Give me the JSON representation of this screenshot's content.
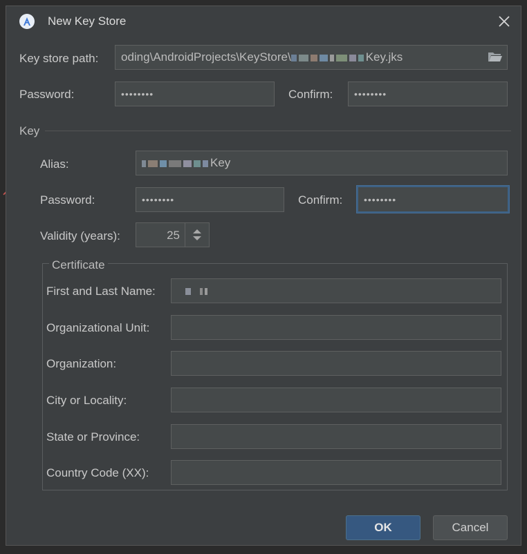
{
  "window": {
    "title": "New Key Store",
    "close_label": "×"
  },
  "keystore": {
    "path_label": "Key store path:",
    "path_value": "oding\\AndroidProjects\\KeyStore\\",
    "path_suffix": "Key.jks",
    "password_label": "Password:",
    "password_value": "••••••••",
    "confirm_label": "Confirm:",
    "confirm_value": "••••••••"
  },
  "key": {
    "section_label": "Key",
    "alias_label": "Alias:",
    "alias_suffix": "Key",
    "password_label": "Password:",
    "password_value": "••••••••",
    "confirm_label": "Confirm:",
    "confirm_value": "••••••••",
    "validity_label": "Validity (years):",
    "validity_value": "25"
  },
  "certificate": {
    "title": "Certificate",
    "fields": [
      {
        "label": "First and Last Name:",
        "value": ""
      },
      {
        "label": "Organizational Unit:",
        "value": ""
      },
      {
        "label": "Organization:",
        "value": ""
      },
      {
        "label": "City or Locality:",
        "value": ""
      },
      {
        "label": "State or Province:",
        "value": ""
      },
      {
        "label": "Country Code (XX):",
        "value": ""
      }
    ]
  },
  "buttons": {
    "ok": "OK",
    "cancel": "Cancel"
  },
  "colors": {
    "dialog_bg": "#3c3f41",
    "field_bg": "#45494a",
    "focus_border": "#3d6185",
    "ok_bg": "#365880"
  },
  "icons": [
    "android-studio-logo-icon",
    "close-icon",
    "folder-open-icon",
    "spinner-up-icon",
    "spinner-down-icon"
  ]
}
